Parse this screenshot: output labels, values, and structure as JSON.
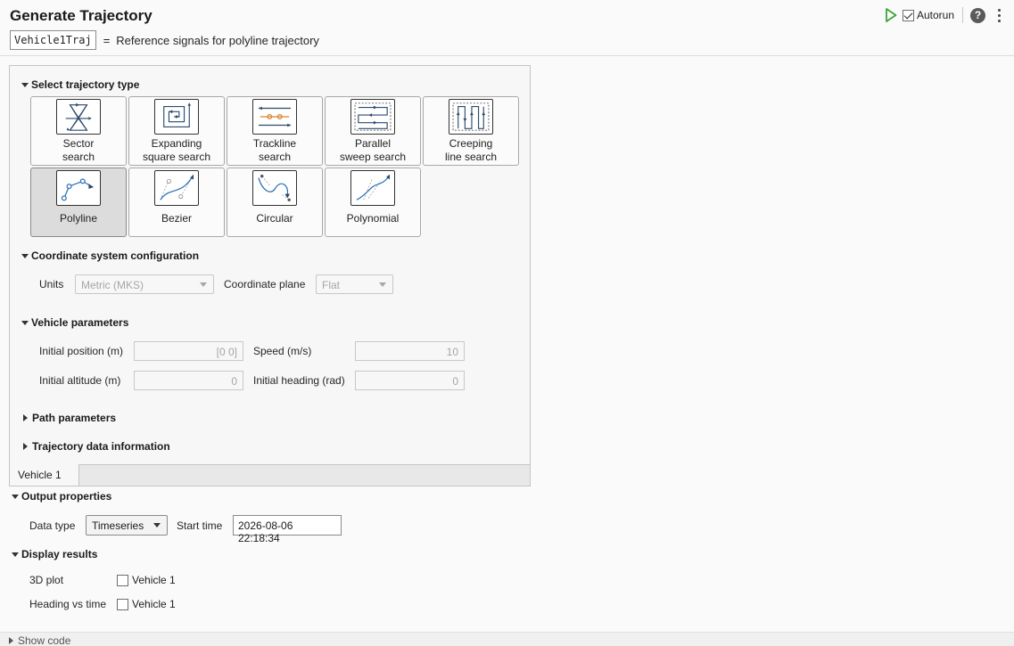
{
  "header": {
    "title": "Generate Trajectory",
    "variable": "Vehicle1Traj",
    "equals": "=",
    "description": "Reference signals for polyline trajectory",
    "autorun_label": "Autorun",
    "autorun_checked": true,
    "help_glyph": "?"
  },
  "sections": {
    "traj_type": "Select trajectory type",
    "coord": "Coordinate system configuration",
    "vehicle": "Vehicle parameters",
    "path": "Path parameters",
    "traj_info": "Trajectory data information",
    "output": "Output properties",
    "display": "Display results"
  },
  "tiles": [
    {
      "line1": "Sector",
      "line2": "search",
      "icon": "sector-search-icon"
    },
    {
      "line1": "Expanding",
      "line2": "square search",
      "icon": "expanding-square-icon"
    },
    {
      "line1": "Trackline",
      "line2": "search",
      "icon": "trackline-search-icon"
    },
    {
      "line1": "Parallel",
      "line2": "sweep search",
      "icon": "parallel-sweep-icon"
    },
    {
      "line1": "Creeping",
      "line2": "line search",
      "icon": "creeping-line-icon"
    },
    {
      "line1": "Polyline",
      "line2": "",
      "icon": "polyline-icon",
      "selected": true
    },
    {
      "line1": "Bezier",
      "line2": "",
      "icon": "bezier-icon"
    },
    {
      "line1": "Circular",
      "line2": "",
      "icon": "circular-icon"
    },
    {
      "line1": "Polynomial",
      "line2": "",
      "icon": "polynomial-icon"
    }
  ],
  "coord": {
    "units_label": "Units",
    "units_value": "Metric (MKS)",
    "plane_label": "Coordinate plane",
    "plane_value": "Flat"
  },
  "vehicle": {
    "init_pos_label": "Initial position (m)",
    "init_pos_value": "[0 0]",
    "speed_label": "Speed (m/s)",
    "speed_value": "10",
    "init_alt_label": "Initial altitude (m)",
    "init_alt_value": "0",
    "init_head_label": "Initial heading (rad)",
    "init_head_value": "0"
  },
  "tab_label": "Vehicle 1",
  "output": {
    "data_type_label": "Data type",
    "data_type_value": "Timeseries",
    "start_time_label": "Start time",
    "start_time_value": "2026-08-06 22:18:34"
  },
  "display": {
    "plot3d_label": "3D plot",
    "plot3d_option": "Vehicle 1",
    "heading_label": "Heading vs time",
    "heading_option": "Vehicle 1"
  },
  "footer": {
    "show_code": "Show code"
  },
  "colors": {
    "run_green": "#3aa53a",
    "accent_blue": "#2a6fb5",
    "accent_orange": "#d9822b"
  }
}
